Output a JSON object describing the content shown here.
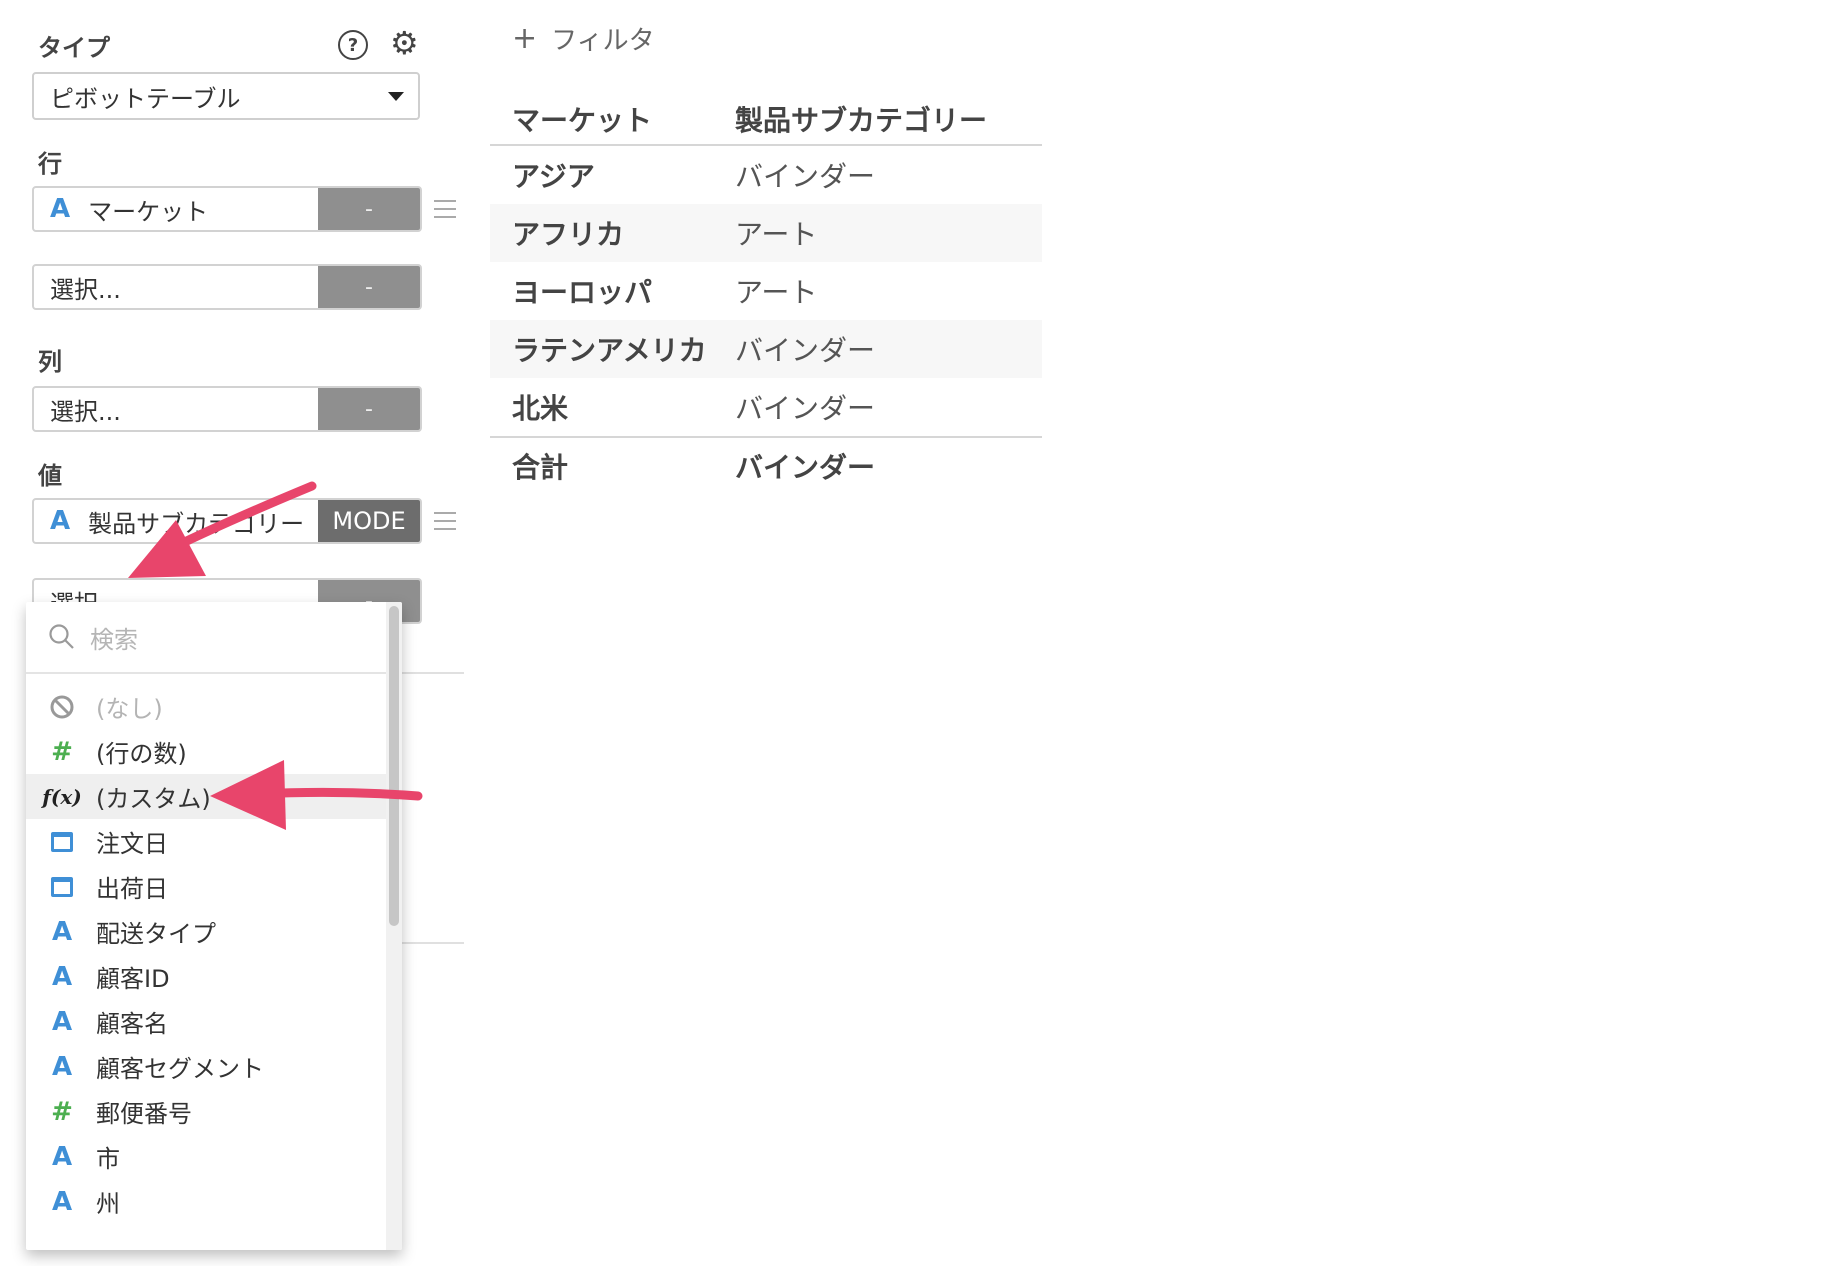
{
  "settings": {
    "type_label": "タイプ",
    "type_value": "ピボットテーブル",
    "help_icon_glyph": "?",
    "gear_icon_glyph": "⚙"
  },
  "rows_section": {
    "label": "行",
    "fields": [
      {
        "icon": "A",
        "name": "マーケット",
        "button": "-"
      },
      {
        "icon": "",
        "name": "選択...",
        "button": "-"
      }
    ]
  },
  "columns_section": {
    "label": "列",
    "fields": [
      {
        "icon": "",
        "name": "選択...",
        "button": "-"
      }
    ]
  },
  "values_section": {
    "label": "値",
    "fields": [
      {
        "icon": "A",
        "name": "製品サブカテゴリー",
        "button": "MODE"
      },
      {
        "icon": "",
        "name": "選択...",
        "button": "-"
      }
    ]
  },
  "dropdown_menu": {
    "search_placeholder": "検索",
    "items": [
      {
        "icon": "none-icon",
        "label": "(なし)"
      },
      {
        "icon": "hash-icon",
        "glyph": "#",
        "label": "(行の数)"
      },
      {
        "icon": "function-icon",
        "glyph": "f(x)",
        "label": "(カスタム)"
      },
      {
        "icon": "calendar-icon",
        "label": "注文日"
      },
      {
        "icon": "calendar-icon",
        "label": "出荷日"
      },
      {
        "icon": "text-type-icon",
        "glyph": "A",
        "label": "配送タイプ"
      },
      {
        "icon": "text-type-icon",
        "glyph": "A",
        "label": "顧客ID"
      },
      {
        "icon": "text-type-icon",
        "glyph": "A",
        "label": "顧客名"
      },
      {
        "icon": "text-type-icon",
        "glyph": "A",
        "label": "顧客セグメント"
      },
      {
        "icon": "hash-icon",
        "glyph": "#",
        "label": "郵便番号"
      },
      {
        "icon": "text-type-icon",
        "glyph": "A",
        "label": "市"
      },
      {
        "icon": "text-type-icon",
        "glyph": "A",
        "label": "州"
      }
    ]
  },
  "filter": {
    "plus": "+",
    "label": "フィルタ"
  },
  "pivot_table": {
    "headers": [
      "マーケット",
      "製品サブカテゴリー"
    ],
    "rows": [
      [
        "アジア",
        "バインダー"
      ],
      [
        "アフリカ",
        "アート"
      ],
      [
        "ヨーロッパ",
        "アート"
      ],
      [
        "ラテンアメリカ",
        "バインダー"
      ],
      [
        "北米",
        "バインダー"
      ]
    ],
    "total": [
      "合計",
      "バインダー"
    ]
  },
  "colors": {
    "accent_blue": "#3f8fd6",
    "hash_green": "#4caf50",
    "annotation_arrow": "#e8456b",
    "button_gray": "#8f8f8f",
    "mode_button": "#6d6d6d"
  }
}
